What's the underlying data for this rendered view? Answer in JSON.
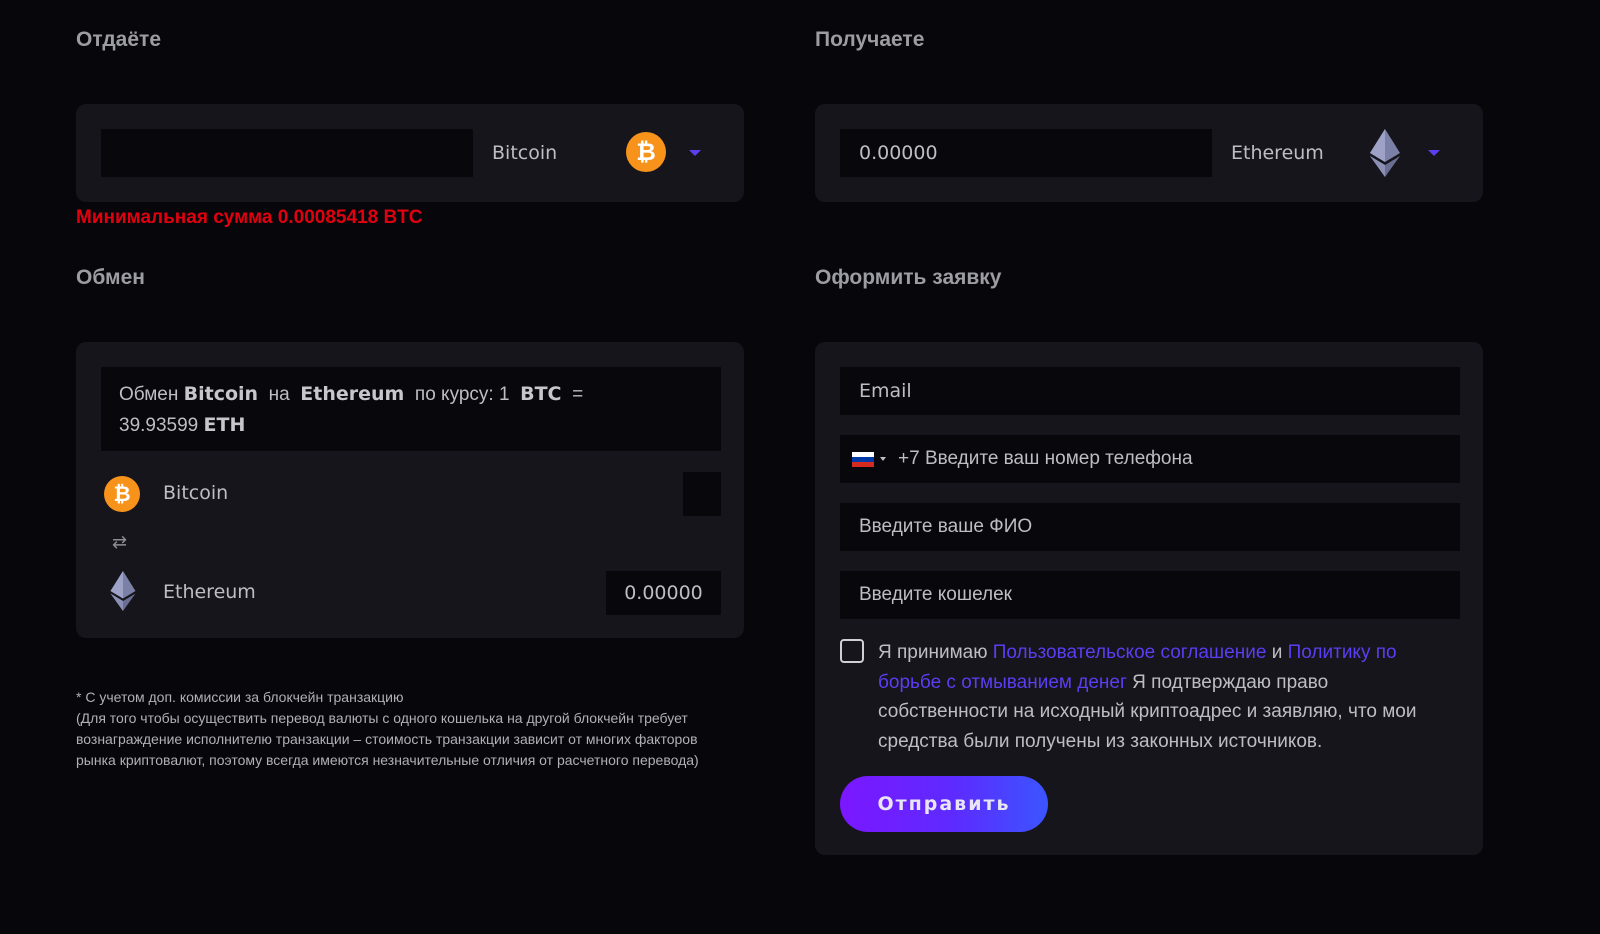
{
  "give": {
    "title": "Отдаёт​е",
    "amount_value": "",
    "currency_name": "Bitcoin",
    "currency_icon": "bitcoin-icon",
    "min_amount_error": "Минимальная сумма 0.00085418 BTC"
  },
  "receive": {
    "title": "Получаете",
    "amount_value": "0.00000",
    "currency_name": "Ethereum",
    "currency_icon": "ethereum-icon"
  },
  "exchange": {
    "title": "Обмен",
    "rate": {
      "prefix": "Обмен",
      "from": "Bitcoin",
      "on": "на",
      "to": "Ethereum",
      "by_rate": "по курсу: 1",
      "from_code": "BTC",
      "equals": "=",
      "value": "39.93599",
      "to_code": "ETH"
    },
    "from_name": "Bitcoin",
    "from_value": "",
    "to_name": "Ethereum",
    "to_value": "0.00000",
    "swap_icon": "swap-icon"
  },
  "note": {
    "line1": "* С учетом доп. комиссии за блокчейн транзакцию",
    "line2": "(Для того чтобы осуществить перевод валюты с одного кошелька на другой блокчейн требует",
    "line3": "вознаграждение исполнителю транзакции – стоимость транзакции зависит от многих факторов",
    "line4": "рынка криптовалют, поэтому всегда имеются незначительные отличия от расчетного перевода)"
  },
  "order": {
    "title": "Оформить заявку",
    "email_placeholder": "Email",
    "phone_prefix": "+7",
    "phone_placeholder": "+7 Введите ваш номер телефона",
    "fio_placeholder": "Введите ваше ФИО",
    "wallet_placeholder": "Введите кошелек",
    "agree": {
      "text1": "Я принимаю",
      "link1": "Пользовательское соглашение",
      "and": "и",
      "link2": "Политику по борьбе с отмыванием денег",
      "text2": "Я подтверждаю право собственности на исходный криптоадрес и заявляю, что мои средства были получены из законных источников."
    },
    "submit_label": "Отправить"
  },
  "colors": {
    "background": "#07060b",
    "card": "#16151b",
    "field": "#08070c",
    "accent": "#5a3ef2",
    "error": "#e0000f",
    "bitcoin": "#f7931a"
  }
}
